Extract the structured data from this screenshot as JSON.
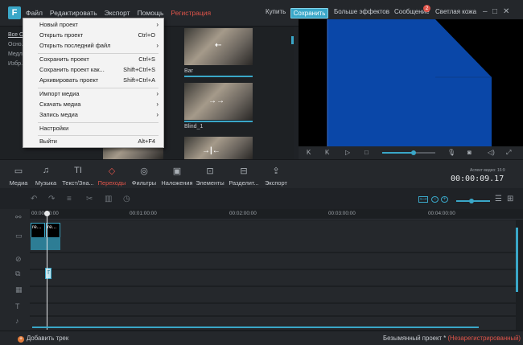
{
  "app": {
    "logo_letter": "F",
    "menu": [
      "Файл",
      "Редактировать",
      "Экспорт",
      "Помощь"
    ],
    "register": "Регистрация",
    "buy": "Купить",
    "save": "Сохранить",
    "more_effects": "Больше эффектов",
    "messages": "Сообщение",
    "messages_count": "2",
    "light_skin": "Светлая кожа"
  },
  "left_nav": [
    "Все О...",
    "Осно...",
    "Медл...",
    "Избр..."
  ],
  "thumbnails": [
    {
      "label": "Bar"
    },
    {
      "label": "Blind_1"
    },
    {
      "label": ""
    }
  ],
  "file_menu": {
    "items": [
      {
        "label": "Новый проект",
        "shortcut": "",
        "submenu": true
      },
      {
        "label": "Открыть проект",
        "shortcut": "Ctrl+O",
        "submenu": false
      },
      {
        "label": "Открыть последний файл",
        "shortcut": "",
        "submenu": true
      },
      {
        "label": "Сохранить проект",
        "shortcut": "Ctrl+S",
        "submenu": false
      },
      {
        "label": "Сохранить проект как...",
        "shortcut": "Shift+Ctrl+S",
        "submenu": false
      },
      {
        "label": "Архивировать проект",
        "shortcut": "Shift+Ctrl+A",
        "submenu": false
      },
      {
        "label": "Импорт медиа",
        "shortcut": "",
        "submenu": true
      },
      {
        "label": "Скачать медиа",
        "shortcut": "",
        "submenu": true
      },
      {
        "label": "Запись медиа",
        "shortcut": "",
        "submenu": true
      },
      {
        "label": "Настройки",
        "shortcut": "",
        "submenu": false
      },
      {
        "label": "Выйти",
        "shortcut": "Alt+F4",
        "submenu": false
      }
    ]
  },
  "toolbar": {
    "items": [
      {
        "label": "Медиа",
        "icon": "folder-icon"
      },
      {
        "label": "Музыка",
        "icon": "music-icon"
      },
      {
        "label": "Текст/Зна...",
        "icon": "text-icon"
      },
      {
        "label": "Переходы",
        "icon": "transitions-icon"
      },
      {
        "label": "Фильтры",
        "icon": "filters-icon"
      },
      {
        "label": "Наложения",
        "icon": "overlays-icon"
      },
      {
        "label": "Элементы",
        "icon": "elements-icon"
      },
      {
        "label": "Разделит...",
        "icon": "split-icon"
      },
      {
        "label": "Экспорт",
        "icon": "export-icon"
      }
    ]
  },
  "aspect_ratio": "Аспект видео: 16:9",
  "timecode": "00:00:09.17",
  "ruler": [
    "00:00:00:00",
    "00:01:00:00",
    "00:02:00:00",
    "00:03:00:00",
    "00:04:00:00"
  ],
  "clips": [
    "re...",
    "re..."
  ],
  "text_clip": "T",
  "status": {
    "add_track": "Добавить трек",
    "project": "Безымянный проект *",
    "unregistered": "(Незарегистрированный)"
  },
  "colors": {
    "accent": "#3aa7c8",
    "active": "#e0544a",
    "preview_blue": "#0a47a8"
  }
}
